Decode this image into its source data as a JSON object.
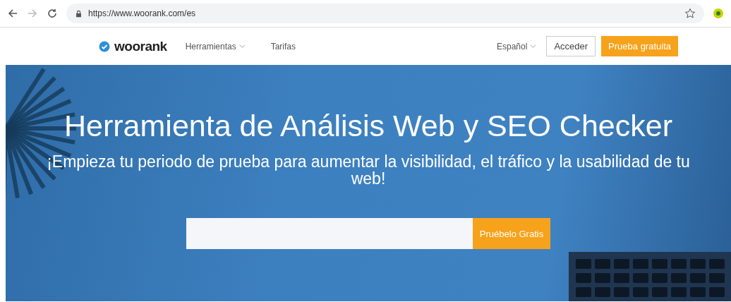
{
  "browser": {
    "url": "https://www.woorank.com/es"
  },
  "nav": {
    "logo": "woorank",
    "items": [
      {
        "label": "Herramientas",
        "dropdown": true
      },
      {
        "label": "Tarifas",
        "dropdown": false
      }
    ],
    "language": "Español",
    "login": "Acceder",
    "cta": "Prueba gratuita"
  },
  "hero": {
    "title": "Herramienta de Análisis Web y SEO Checker",
    "subtitle": "¡Empieza tu periodo de prueba para aumentar la visibilidad, el tráfico y la usabilidad de tu web!",
    "button": "Pruébelo Gratis"
  }
}
